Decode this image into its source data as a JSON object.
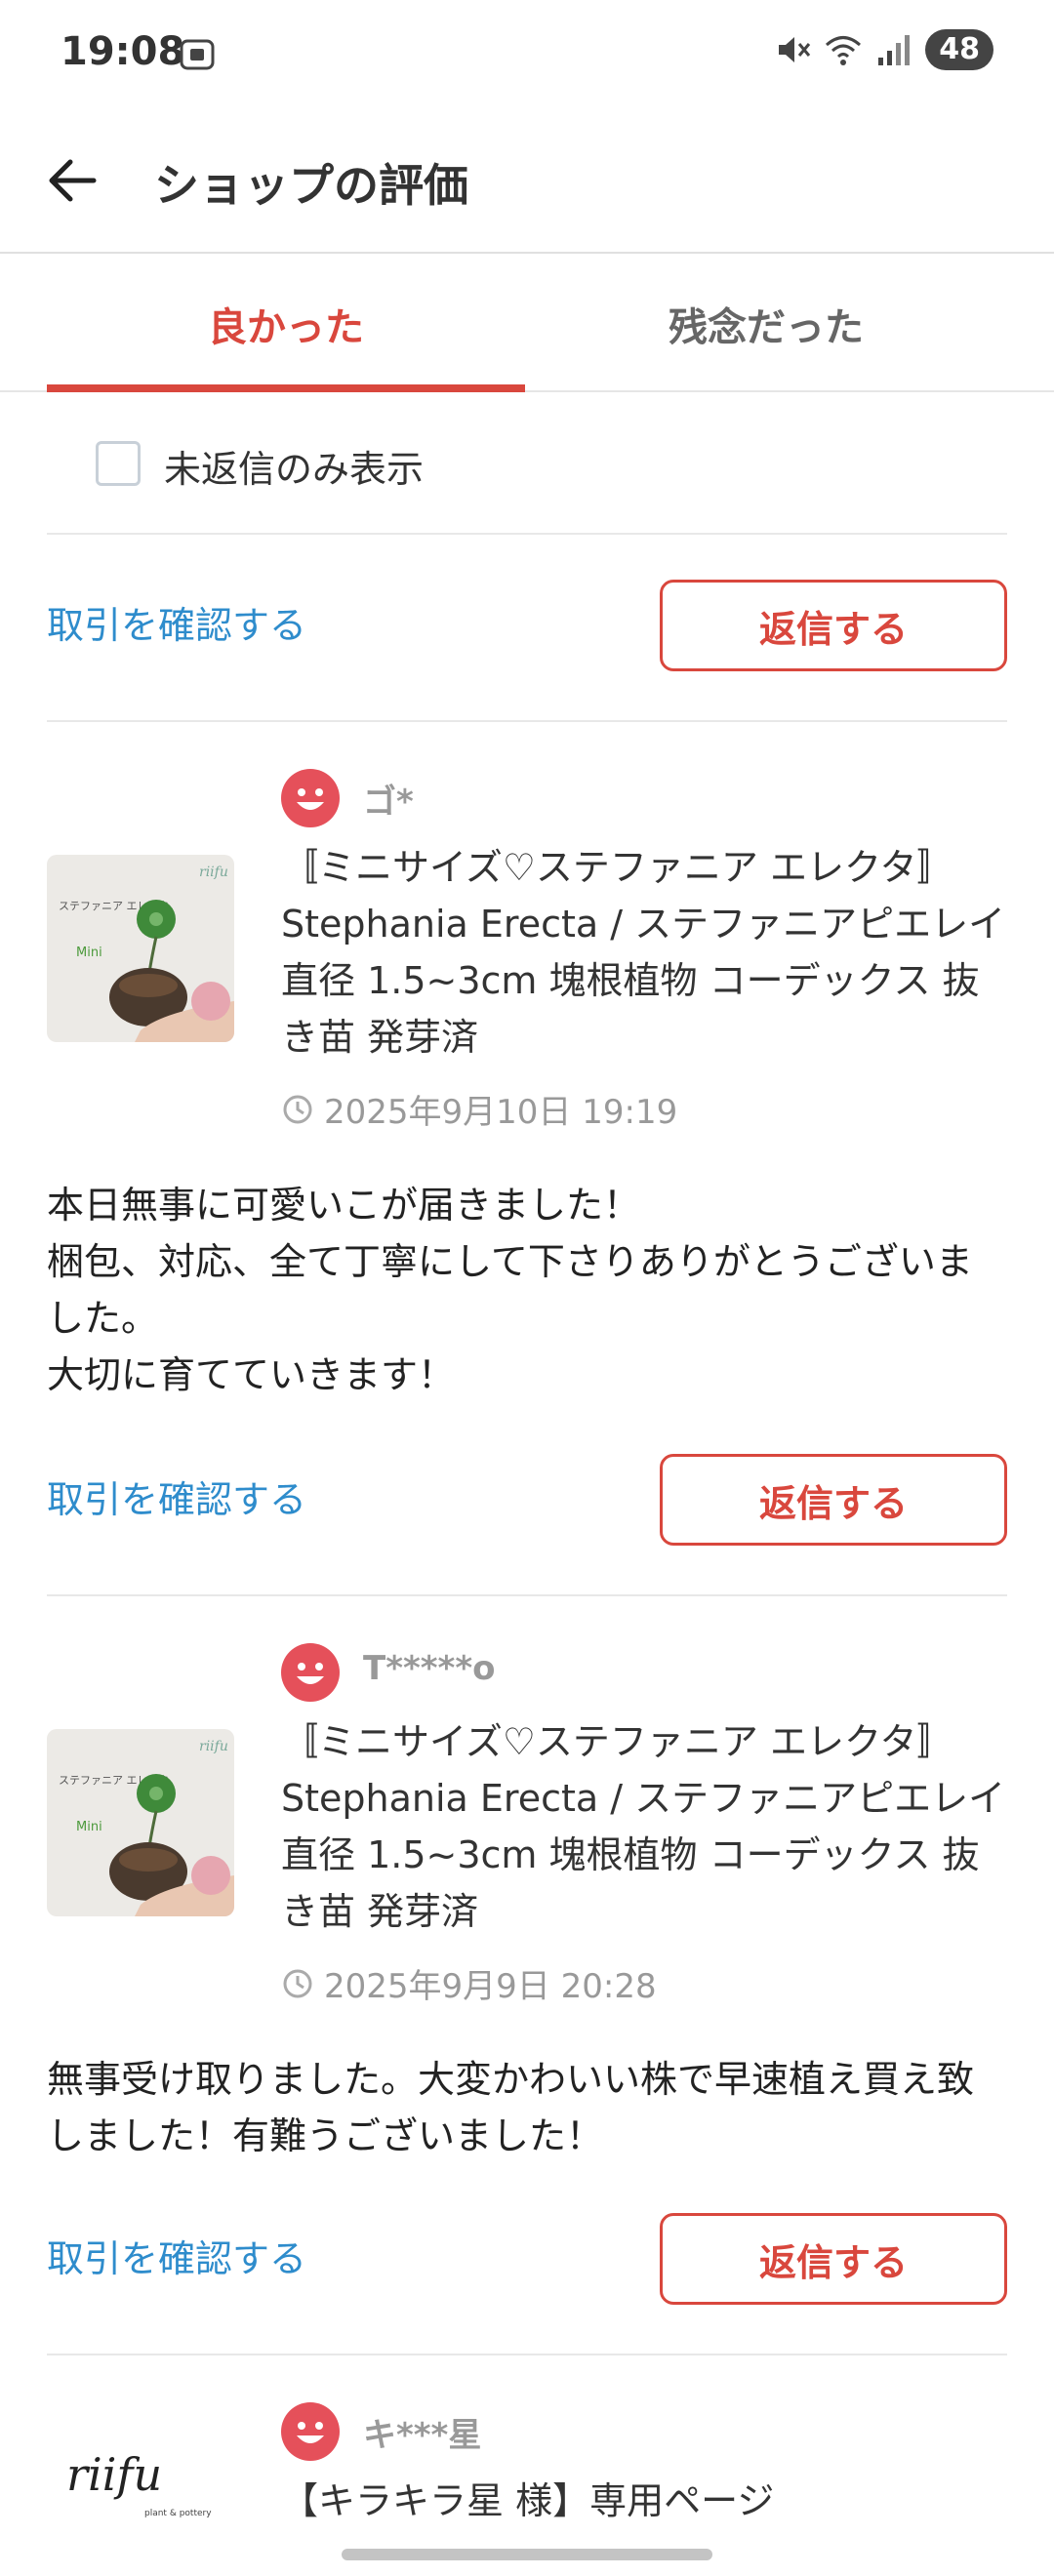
{
  "status_bar": {
    "time": "19:08",
    "battery": "48",
    "icons": [
      "screenshot-icon",
      "mute-icon",
      "wifi-icon",
      "signal-icon"
    ]
  },
  "header": {
    "title": "ショップの評価",
    "back_icon": "back-arrow-icon"
  },
  "tabs": [
    {
      "label": "良かった",
      "active": true
    },
    {
      "label": "残念だった",
      "active": false
    }
  ],
  "filter": {
    "label": "未返信のみ表示",
    "checked": false
  },
  "actions": {
    "confirm_label": "取引を確認する",
    "reply_label": "返信する"
  },
  "reviews": [
    {
      "reviewer": "ゴ*",
      "product": "〚ミニサイズ♡ステファニア エレクタ〛 Stephania Erecta / ステファニアピエレイ 直径 1.5~3cm 塊根植物 コーデックス 抜き苗 発芽済",
      "date": "2025年9月10日 19:19",
      "comment": "本日無事に可愛いこが届きました！\n梱包、対応、全て丁寧にして下さりありがとうございました。\n大切に育てていきます！"
    },
    {
      "reviewer": "T*****o",
      "product": "〚ミニサイズ♡ステファニア エレクタ〛 Stephania Erecta / ステファニアピエレイ 直径 1.5~3cm 塊根植物 コーデックス 抜き苗 発芽済",
      "date": "2025年9月9日 20:28",
      "comment": "無事受け取りました。大変かわいい株で早速植え買え致しました！有難うございました！"
    },
    {
      "reviewer": "キ***星",
      "product": "【キラキラ星 様】専用ページ"
    }
  ],
  "thumbnail_text": {
    "plant_label": "ステファニア エレクタ",
    "mini": "Mini",
    "brand": "riifu",
    "brand_sub": "plant & pottery"
  },
  "colors": {
    "accent": "#d9473d",
    "link": "#2e8ccc",
    "avatar": "#e5505a"
  }
}
